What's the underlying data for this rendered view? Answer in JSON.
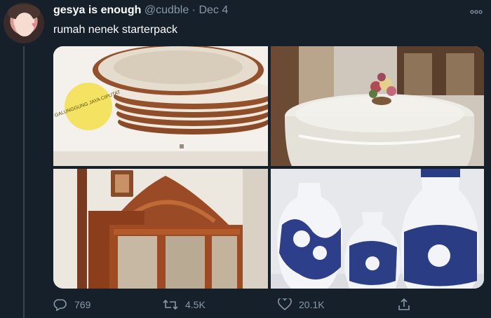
{
  "tweet": {
    "display_name": "gesya is enough",
    "handle": "@cudble",
    "separator": "·",
    "date": "Dec 4",
    "text": "rumah nenek starterpack",
    "stamp_text": "GALUNGGUNG JAYA CIPUTAT"
  },
  "actions": {
    "replies": "769",
    "retweets": "4.5K",
    "likes": "20.1K"
  },
  "icons": {
    "reply": "reply-icon",
    "retweet": "retweet-icon",
    "like": "heart-icon",
    "share": "share-icon",
    "more": "more-icon"
  },
  "colors": {
    "background": "#15202b",
    "text": "#ffffff",
    "muted": "#8899a6",
    "thread_line": "#38444d"
  }
}
